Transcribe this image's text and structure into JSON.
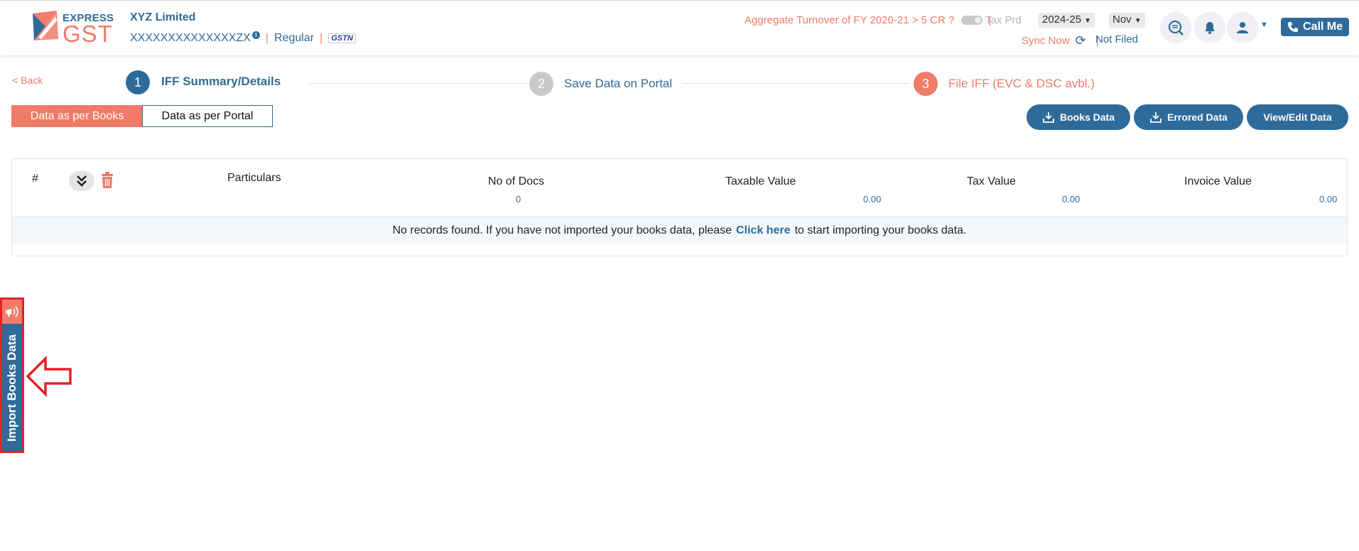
{
  "brand": {
    "line1": "EXPRESS",
    "line2": "GST"
  },
  "company": {
    "name": "XYZ Limited",
    "gstin": "XXXXXXXXXXXXXXZX",
    "info_icon": "i",
    "type": "Regular",
    "gstn_badge": "GSTN"
  },
  "header": {
    "turnover_label": "Aggregate Turnover of FY 2020-21 > 5 CR ?",
    "tax_period_label": "Tax Prd",
    "year": "2024-25",
    "month": "Nov",
    "sync_label": "Sync Now",
    "status": "Not Filed",
    "call_label": "Call Me",
    "separator": "|"
  },
  "nav": {
    "back": "< Back"
  },
  "steps": [
    {
      "num": "1",
      "label": "IFF Summary/Details"
    },
    {
      "num": "2",
      "label": "Save Data on Portal"
    },
    {
      "num": "3",
      "label": "File IFF (EVC & DSC avbl.)"
    }
  ],
  "tabs": {
    "books": "Data as per Books",
    "portal": "Data as per Portal"
  },
  "actions": {
    "books_data": "Books Data",
    "errored_data": "Errored Data",
    "view_edit": "View/Edit Data"
  },
  "table": {
    "headers": {
      "index": "#",
      "particulars": "Particulars",
      "docs": "No of Docs",
      "taxable": "Taxable Value",
      "tax": "Tax Value",
      "invoice": "Invoice Value"
    },
    "totals": {
      "docs": "0",
      "taxable": "0.00",
      "tax": "0.00",
      "invoice": "0.00"
    },
    "empty": {
      "before": "No records found. If you have not imported your books data, please",
      "link": "Click here",
      "after": "to start importing your books data."
    }
  },
  "sidebar": {
    "import_label": "Import Books Data"
  },
  "colors": {
    "primary": "#2f6b9a",
    "accent": "#f07b68",
    "highlight": "#e0222a"
  },
  "icons": [
    "search-doc-icon",
    "bell-icon",
    "user-icon",
    "phone-icon",
    "refresh-icon",
    "download-icon",
    "chevron-double-down-icon",
    "trash-icon",
    "megaphone-icon",
    "arrow-left-icon"
  ]
}
